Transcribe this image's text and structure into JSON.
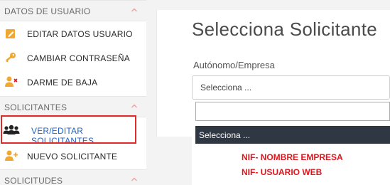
{
  "sidebar": {
    "sections": [
      {
        "header": "DATOS DE USUARIO",
        "items": [
          "EDITAR DATOS USUARIO",
          "CAMBIAR CONTRASEÑA",
          "DARME DE BAJA"
        ]
      },
      {
        "header": "SOLICITANTES",
        "items": [
          "VER/EDITAR SOLICITANTES",
          "NUEVO SOLICITANTE"
        ]
      },
      {
        "header": "SOLICITUDES",
        "items": []
      }
    ],
    "active_item": "VER/EDITAR SOLICITANTES",
    "chevron": "^"
  },
  "main": {
    "title": "Selecciona Solicitante",
    "field_label": "Autónomo/Empresa",
    "select_value": "Selecciona ...",
    "search_value": "",
    "dropdown_options": [
      "Selecciona ...",
      "NIF- NOMBRE EMPRESA",
      "NIF- USUARIO WEB"
    ]
  },
  "colors": {
    "highlight_box": "#e02b2b",
    "active_link": "#1e63c3",
    "option_text": "#e0161d",
    "selected_option_bg": "#2f3742",
    "icon_orange": "#f0a830"
  },
  "icons": {
    "edit": "edit-icon",
    "key": "key-icon",
    "user_remove": "user-remove-icon",
    "users": "users-icon",
    "user_add": "user-add-icon",
    "chevron": "chevron-up-icon"
  }
}
